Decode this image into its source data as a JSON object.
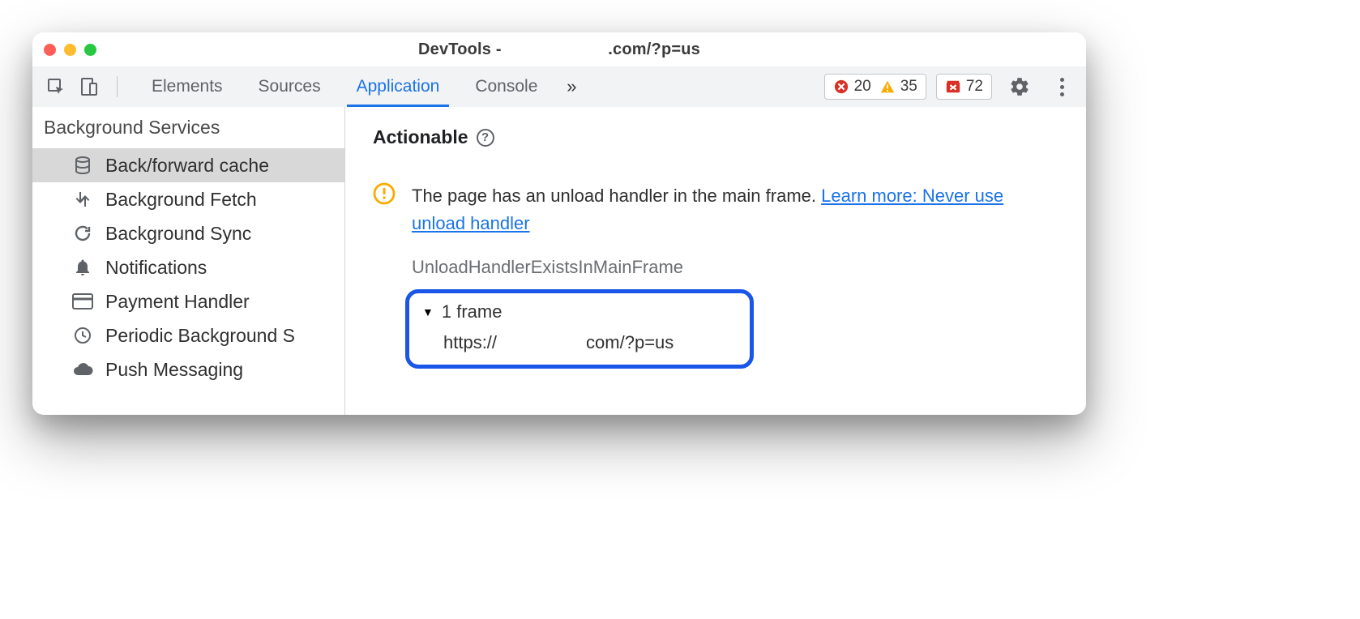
{
  "window": {
    "title_prefix": "DevTools -",
    "title_domain": ".com/?p=us"
  },
  "toolbar": {
    "tabs": [
      "Elements",
      "Sources",
      "Application",
      "Console"
    ],
    "active_tab_index": 2,
    "expand_glyph": "»",
    "error_badge": {
      "count": "20"
    },
    "warn_badge": {
      "count": "35"
    },
    "issue_badge": {
      "count": "72"
    }
  },
  "sidebar": {
    "section_title": "Background Services",
    "items": [
      {
        "label": "Back/forward cache",
        "icon": "db"
      },
      {
        "label": "Background Fetch",
        "icon": "updown"
      },
      {
        "label": "Background Sync",
        "icon": "sync"
      },
      {
        "label": "Notifications",
        "icon": "bell"
      },
      {
        "label": "Payment Handler",
        "icon": "card"
      },
      {
        "label": "Periodic Background S",
        "icon": "clock"
      },
      {
        "label": "Push Messaging",
        "icon": "cloud"
      }
    ],
    "selected_index": 0
  },
  "main": {
    "heading": "Actionable",
    "message_text": "The page has an unload handler in the main frame. ",
    "message_link": "Learn more: Never use unload handler",
    "reason": "UnloadHandlerExistsInMainFrame",
    "frame_count_label": "1 frame",
    "frame_url_scheme": "https://",
    "frame_url_tail": "com/?p=us"
  }
}
